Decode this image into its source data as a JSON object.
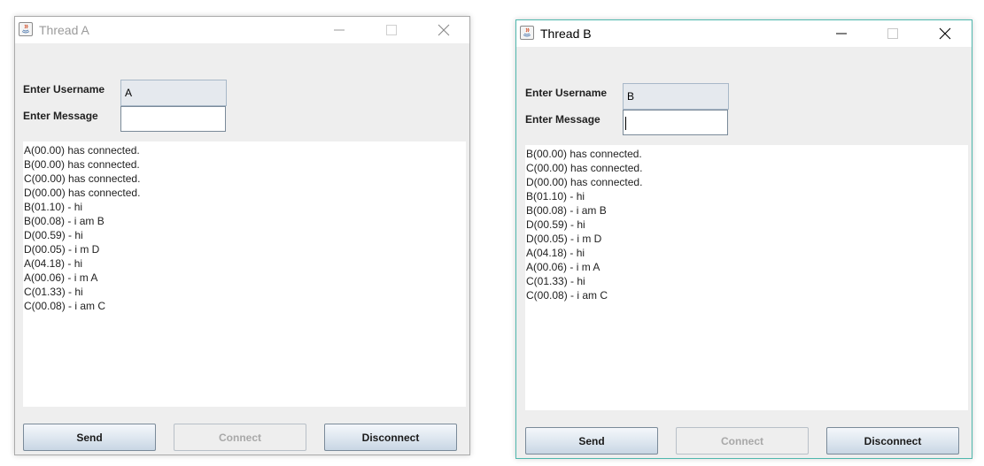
{
  "windows": {
    "a": {
      "title": "Thread A",
      "username_label": "Enter Username",
      "username_value": "A",
      "message_label": "Enter Message",
      "message_value": "",
      "log": [
        "A(00.00) has connected.",
        "B(00.00) has connected.",
        "C(00.00) has connected.",
        "D(00.00) has connected.",
        "B(01.10) - hi",
        "B(00.08) - i am B",
        "D(00.59) - hi",
        "D(00.05) - i m D",
        "A(04.18) - hi",
        "A(00.06) - i m A",
        "C(01.33) - hi",
        "C(00.08) - i am C"
      ],
      "buttons": {
        "send": "Send",
        "connect": "Connect",
        "disconnect": "Disconnect"
      }
    },
    "b": {
      "title": "Thread B",
      "username_label": "Enter Username",
      "username_value": "B",
      "message_label": "Enter Message",
      "message_value": "",
      "log": [
        "B(00.00) has connected.",
        "C(00.00) has connected.",
        "D(00.00) has connected.",
        "B(01.10) - hi",
        "B(00.08) - i am B",
        "D(00.59) - hi",
        "D(00.05) - i m D",
        "A(04.18) - hi",
        "A(00.06) - i m A",
        "C(01.33) - hi",
        "C(00.08) - i am C"
      ],
      "buttons": {
        "send": "Send",
        "connect": "Connect",
        "disconnect": "Disconnect"
      }
    }
  },
  "colors": {
    "window_bg": "#eeeeee",
    "active_border": "#4fb7ad",
    "inactive_title": "#9b9b9b"
  },
  "icons": [
    "java-app-icon",
    "minimize-icon",
    "maximize-icon",
    "close-icon"
  ]
}
